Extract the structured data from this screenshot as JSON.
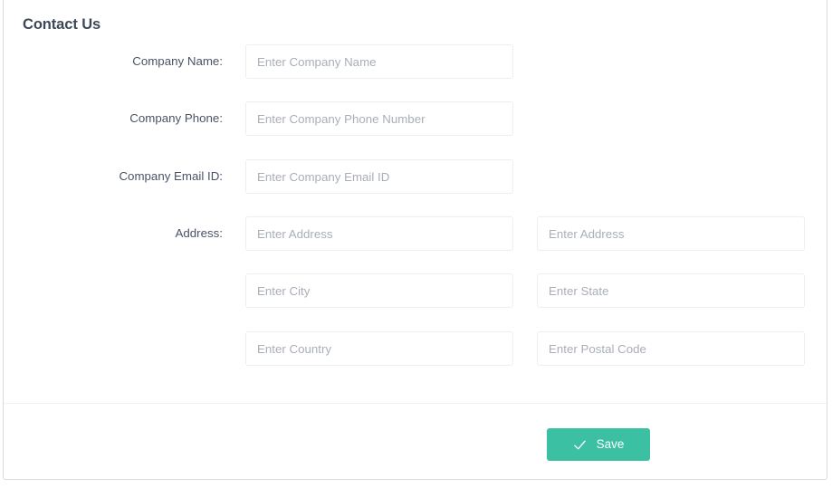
{
  "card": {
    "title": "Contact Us"
  },
  "form": {
    "rows": [
      {
        "label": "Company Name:",
        "left_placeholder": "Enter Company Name",
        "right_placeholder": null
      },
      {
        "label": "Company Phone:",
        "left_placeholder": "Enter Company Phone Number",
        "right_placeholder": null
      },
      {
        "label": "Company Email ID:",
        "left_placeholder": "Enter Company Email ID",
        "right_placeholder": null
      },
      {
        "label": "Address:",
        "left_placeholder": "Enter Address",
        "right_placeholder": "Enter Address"
      },
      {
        "label": "",
        "left_placeholder": "Enter City",
        "right_placeholder": "Enter State"
      },
      {
        "label": "",
        "left_placeholder": "Enter Country",
        "right_placeholder": "Enter Postal Code"
      }
    ],
    "values": {
      "company_name": "",
      "company_phone": "",
      "company_email": "",
      "address_line_1": "",
      "address_line_2": "",
      "city": "",
      "state": "",
      "country": "",
      "postal_code": ""
    }
  },
  "footer": {
    "save_label": "Save",
    "save_icon": "check-icon",
    "save_color": "#3bc0a4"
  },
  "colors": {
    "accent": "#3bc0a4",
    "title_text": "#3c4858",
    "label_text": "#4a5366",
    "placeholder_text": "#a9aeb8",
    "field_border": "#eceef1",
    "card_border": "#d8dade",
    "divider": "#eef0f2",
    "background": "#ffffff"
  }
}
